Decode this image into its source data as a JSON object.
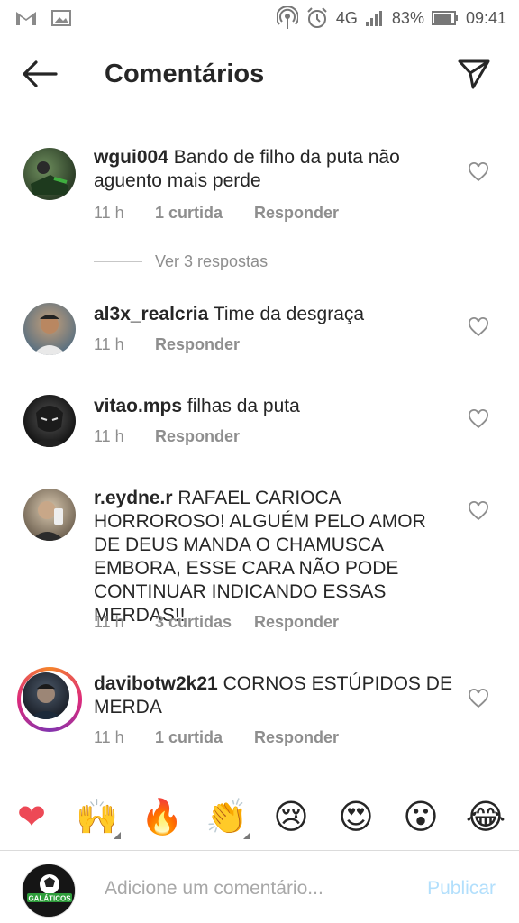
{
  "status_bar": {
    "battery": "83%",
    "time": "09:41",
    "network": "4G"
  },
  "header": {
    "title": "Comentários"
  },
  "comments": [
    {
      "user": "wgui004",
      "text": "Bando de filho da puta não aguento mais perde",
      "time": "11 h",
      "likes": "1 curtida",
      "reply": "Responder",
      "view_replies": "Ver 3 respostas"
    },
    {
      "user": "al3x_realcria",
      "text": "Time da desgraça",
      "time": "11 h",
      "reply": "Responder"
    },
    {
      "user": "vitao.mps",
      "text": "filhas da puta",
      "time": "11 h",
      "reply": "Responder"
    },
    {
      "user": "r.eydne.r",
      "text": "RAFAEL CARIOCA HORROROSO! ALGUÉM PELO AMOR DE DEUS MANDA O CHAMUSCA EMBORA, ESSE CARA NÃO PODE CONTINUAR INDICANDO ESSAS MERDAS!!",
      "time": "11 h",
      "likes": "3 curtidas",
      "reply": "Responder"
    },
    {
      "user": "davibotw2k21",
      "text": "CORNOS ESTÚPIDOS DE MERDA",
      "time": "11 h",
      "likes": "1 curtida",
      "reply": "Responder"
    }
  ],
  "emoji_bar": [
    "❤",
    "🙌",
    "🔥",
    "👏",
    "😢",
    "😍",
    "😮",
    "😂"
  ],
  "composer": {
    "placeholder": "Adicione um comentário...",
    "publish": "Publicar",
    "avatar_logo_text": "GALÁTICOS"
  },
  "colors": {
    "text": "#262626",
    "muted": "#8e8e8e",
    "publish_disabled": "#b2dffc",
    "heart": "#ed4956"
  }
}
